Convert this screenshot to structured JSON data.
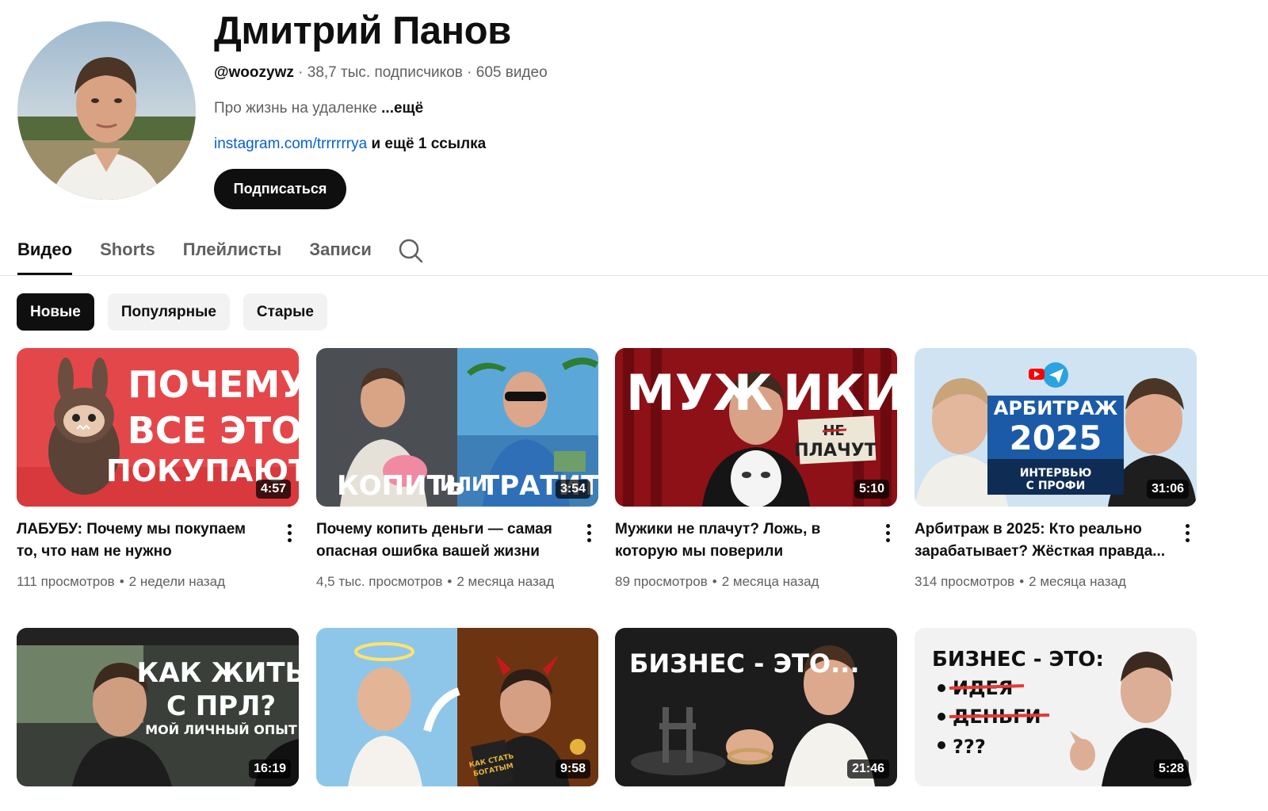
{
  "channel": {
    "name": "Дмитрий Панов",
    "handle": "@woozywz",
    "subscribers": "38,7 тыс. подписчиков",
    "videos_count": "605 видео",
    "description": "Про жизнь на удаленке",
    "more_label": "...ещё",
    "link_text": "instagram.com/trrrrrrya",
    "more_links": "и ещё 1 ссылка",
    "subscribe_label": "Подписаться"
  },
  "tabs": [
    {
      "label": "Видео",
      "active": true
    },
    {
      "label": "Shorts",
      "active": false
    },
    {
      "label": "Плейлисты",
      "active": false
    },
    {
      "label": "Записи",
      "active": false
    }
  ],
  "chips": [
    {
      "label": "Новые",
      "active": true
    },
    {
      "label": "Популярные",
      "active": false
    },
    {
      "label": "Старые",
      "active": false
    }
  ],
  "videos": [
    {
      "title": "ЛАБУБУ: Почему мы покупаем то, что нам не нужно",
      "views": "111 просмотров",
      "age": "2 недели назад",
      "duration": "4:57",
      "thumb_text": [
        "ПОЧЕМУ",
        "ВСЕ ЭТО",
        "ПОКУПАЮТ?"
      ]
    },
    {
      "title": "Почему копить деньги — самая опасная ошибка вашей жизни",
      "views": "4,5 тыс. просмотров",
      "age": "2 месяца назад",
      "duration": "3:54",
      "thumb_text": [
        "КОПИТЬ",
        "ИЛИ",
        "ТРАТИТЬ"
      ]
    },
    {
      "title": "Мужики не плачут? Ложь, в которую мы поверили",
      "views": "89 просмотров",
      "age": "2 месяца назад",
      "duration": "5:10",
      "thumb_text": [
        "МУЖ",
        "ИКИ",
        "НЕ",
        "ПЛАЧУТ"
      ]
    },
    {
      "title": "Арбитраж в 2025: Кто реально зарабатывает? Жёсткая правда...",
      "views": "314 просмотров",
      "age": "2 месяца назад",
      "duration": "31:06",
      "thumb_text": [
        "АРБИТРАЖ",
        "2025",
        "ИНТЕРВЬЮ",
        "С ПРОФИ"
      ]
    },
    {
      "title": "",
      "views": "",
      "age": "",
      "duration": "16:19",
      "thumb_text": [
        "КАК ЖИТЬ",
        "С ПРЛ?",
        "МОЙ ЛИЧНЫЙ ОПЫТ"
      ]
    },
    {
      "title": "",
      "views": "",
      "age": "",
      "duration": "9:58",
      "thumb_text": [
        "КАК СТАТЬ",
        "БОГАТЫМ"
      ]
    },
    {
      "title": "",
      "views": "",
      "age": "",
      "duration": "21:46",
      "thumb_text": [
        "БИЗНЕС - ЭТО..."
      ]
    },
    {
      "title": "",
      "views": "",
      "age": "",
      "duration": "5:28",
      "thumb_text": [
        "БИЗНЕС - ЭТО:",
        "ИДЕЯ",
        "ДЕНЬГИ",
        "???"
      ]
    }
  ],
  "colors": {
    "accent_link": "#065fd4",
    "text_primary": "#0f0f0f",
    "text_secondary": "#606060",
    "chip_bg": "#f2f2f2"
  }
}
